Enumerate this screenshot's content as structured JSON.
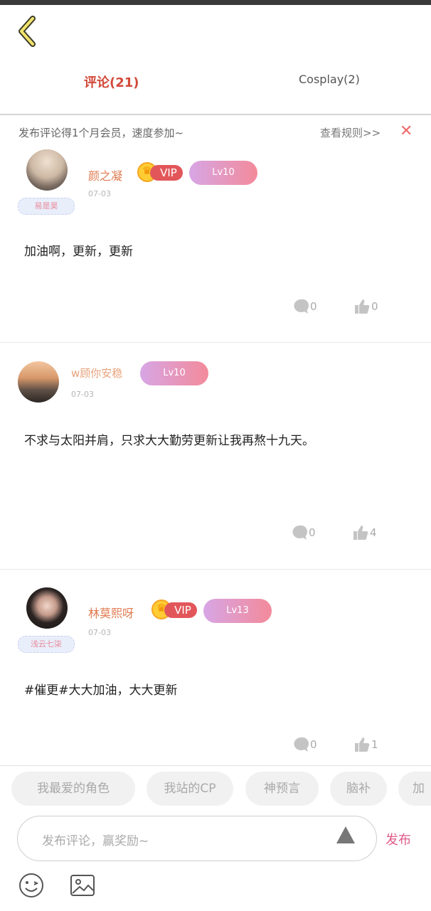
{
  "tabs": {
    "comments": "评论(21)",
    "cosplay": "Cosplay(2)"
  },
  "notice": {
    "text": "发布评论得1个月会员，速度参加~",
    "rules": "查看规则>>",
    "close": "✕"
  },
  "comments": [
    {
      "username": "颜之凝",
      "vip": "VIP",
      "level": "Lv10",
      "date": "07-03",
      "frame_tag": "易是昊",
      "text": "加油啊，更新，更新",
      "reply_count": "0",
      "like_count": "0"
    },
    {
      "username": "w顾你安稳",
      "level": "Lv10",
      "date": "07-03",
      "text": "不求与太阳并肩，只求大大勤劳更新让我再熬十九天。",
      "reply_count": "0",
      "like_count": "4"
    },
    {
      "username": "林莫熙呀",
      "vip": "VIP",
      "level": "Lv13",
      "date": "07-03",
      "frame_tag": "浅云七柒",
      "text": "#催更#大大加油，大大更新",
      "reply_count": "0",
      "like_count": "1"
    }
  ],
  "quick_tags": [
    "我最爱的角色",
    "我站的CP",
    "神预言",
    "脑补",
    "加油"
  ],
  "input": {
    "placeholder": "发布评论，赢奖励~",
    "publish_label": "发布"
  },
  "colors": {
    "accent": "#d24a3a",
    "level_gradient_start": "#d7a6e5",
    "level_gradient_end": "#f38a9a",
    "vip_red": "#e2565a",
    "publish": "#e05a8a"
  }
}
